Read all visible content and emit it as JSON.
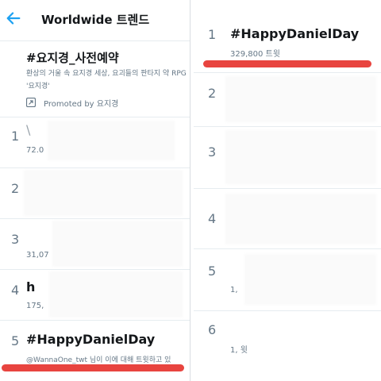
{
  "left": {
    "header": {
      "title": "Worldwide 트렌드"
    },
    "promoted": {
      "title": "#요지경_사전예약",
      "description": "환상의 거울 속 요지경 세상, 요괴들의 판타지 약 RPG '요지경'",
      "promoted_by": "Promoted by 요지경"
    },
    "trends": [
      {
        "rank": "1",
        "name": "\\",
        "meta": "72.0"
      },
      {
        "rank": "2",
        "name": "",
        "meta": ""
      },
      {
        "rank": "3",
        "name": "",
        "meta": "31,07"
      },
      {
        "rank": "4",
        "name": "h",
        "meta": "175,"
      },
      {
        "rank": "5",
        "name": "#HappyDanielDay",
        "meta": "@WannaOne_twt 님이 이에 대해 트윗하고 있"
      }
    ]
  },
  "right": {
    "trends": [
      {
        "rank": "1",
        "name": "#HappyDanielDay",
        "meta": "329,800 트윗"
      },
      {
        "rank": "2",
        "name": "",
        "meta": ""
      },
      {
        "rank": "3",
        "name": "",
        "meta": ""
      },
      {
        "rank": "4",
        "name": "",
        "meta": ""
      },
      {
        "rank": "5",
        "name": "",
        "meta": "1,"
      },
      {
        "rank": "6",
        "name": "",
        "meta": "1,        윗"
      }
    ]
  },
  "colors": {
    "accent": "#1da1f2",
    "highlight": "#e8443f",
    "secondary_text": "#657786"
  }
}
